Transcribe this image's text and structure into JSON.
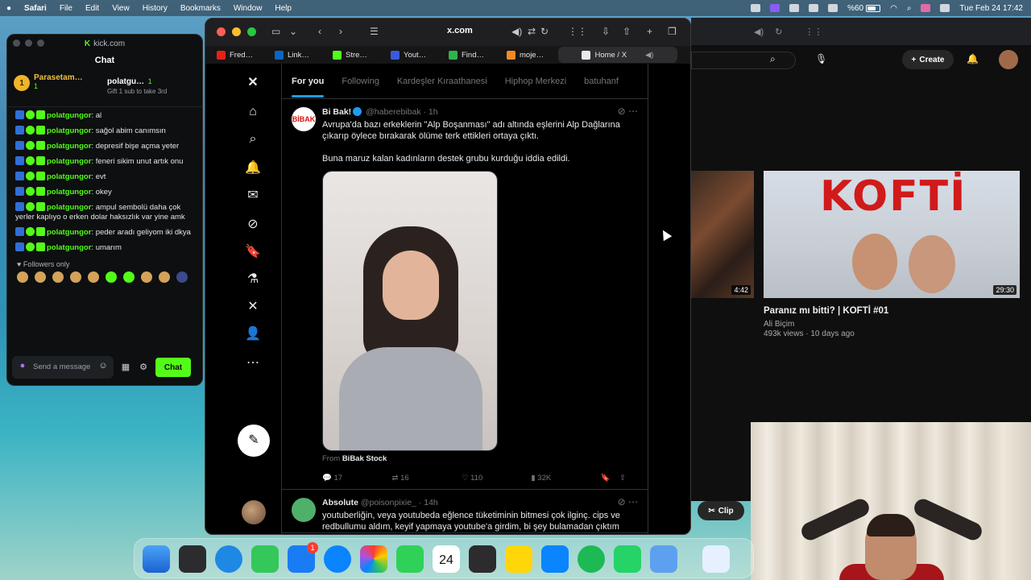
{
  "menubar": {
    "app": "Safari",
    "items": [
      "File",
      "Edit",
      "View",
      "History",
      "Bookmarks",
      "Window",
      "Help"
    ],
    "battery": "%60",
    "datetime": "Tue Feb 24  17:42"
  },
  "kick": {
    "window_title": "kick.com",
    "chat_title": "Chat",
    "pinned": [
      {
        "rank": "1",
        "name": "Parasetam…",
        "count": "1"
      },
      {
        "name": "polatgu…",
        "count": "1",
        "sub": "Gift 1 sub to take 3rd"
      }
    ],
    "messages": [
      {
        "user": "polatgungor",
        "text": "al"
      },
      {
        "user": "polatgungor",
        "text": "sağol abim canımsın"
      },
      {
        "user": "polatgungor",
        "text": "depresif bişe açma yeter"
      },
      {
        "user": "polatgungor",
        "text": "feneri sikim unut artık onu"
      },
      {
        "user": "polatgungor",
        "text": "evt"
      },
      {
        "user": "polatgungor",
        "text": "okey"
      },
      {
        "user": "polatgungor",
        "text": "ampul sembolü daha çok yerler kaplıyo o erken dolar haksızlık var yine amk"
      },
      {
        "user": "polatgungor",
        "text": "peder aradı geliyom iki dkya"
      },
      {
        "user": "polatgungor",
        "text": "umarım"
      }
    ],
    "followers_only": "Followers only",
    "input_placeholder": "Send a message",
    "chat_button": "Chat"
  },
  "safari": {
    "url": "x.com",
    "tabs": [
      {
        "label": "Fred…",
        "color": "#e62117"
      },
      {
        "label": "Link…",
        "color": "#0a66c2"
      },
      {
        "label": "Stre…",
        "color": "#53fc18"
      },
      {
        "label": "Yout…",
        "color": "#3b5bdb"
      },
      {
        "label": "Find…",
        "color": "#2fb34a"
      },
      {
        "label": "moje…",
        "color": "#f08a24"
      },
      {
        "label": "Home / X",
        "color": "#e7e9ea"
      }
    ]
  },
  "x": {
    "tabs": [
      "For you",
      "Following",
      "Kardeşler Kıraathanesi",
      "Hiphop Merkezi",
      "batuhanf"
    ],
    "tweets": [
      {
        "name": "Bi Bak!",
        "handle": "@haberebibak",
        "time": "· 1h",
        "avatar": "BİBAK",
        "text": "Avrupa'da bazı erkeklerin \"Alp Boşanması\" adı altında eşlerini Alp Dağlarına çıkarıp öylece bırakarak ölüme terk ettikleri ortaya çıktı.\n\nBuna maruz kalan kadınların destek grubu kurduğu iddia edildi.",
        "from_prefix": "From",
        "from_source": "BiBak Stock",
        "replies": "17",
        "reposts": "16",
        "likes": "110",
        "views": "32K"
      },
      {
        "name": "Absolute",
        "handle": "@poisonpixie_",
        "time": "· 14h",
        "text": "youtuberliğin, veya youtubeda eğlence tüketiminin bitmesi çok ilginç. cips ve redbullumu aldım, keyif yapmaya youtube'a girdim, bi şey bulamadan çıktım"
      }
    ]
  },
  "youtube": {
    "create": "Create",
    "thumb1_duration": "4:42",
    "thumb2_title_text": "KOFTİ",
    "thumb2_duration": "29:30",
    "video_title": "Paranız mı bitti? | KOFTİ #01",
    "channel": "Ali Biçim",
    "meta": "493k views · 10 days ago",
    "clip": "Clip"
  },
  "dock": {
    "calendar_day": "24",
    "mail_badge": "1"
  }
}
